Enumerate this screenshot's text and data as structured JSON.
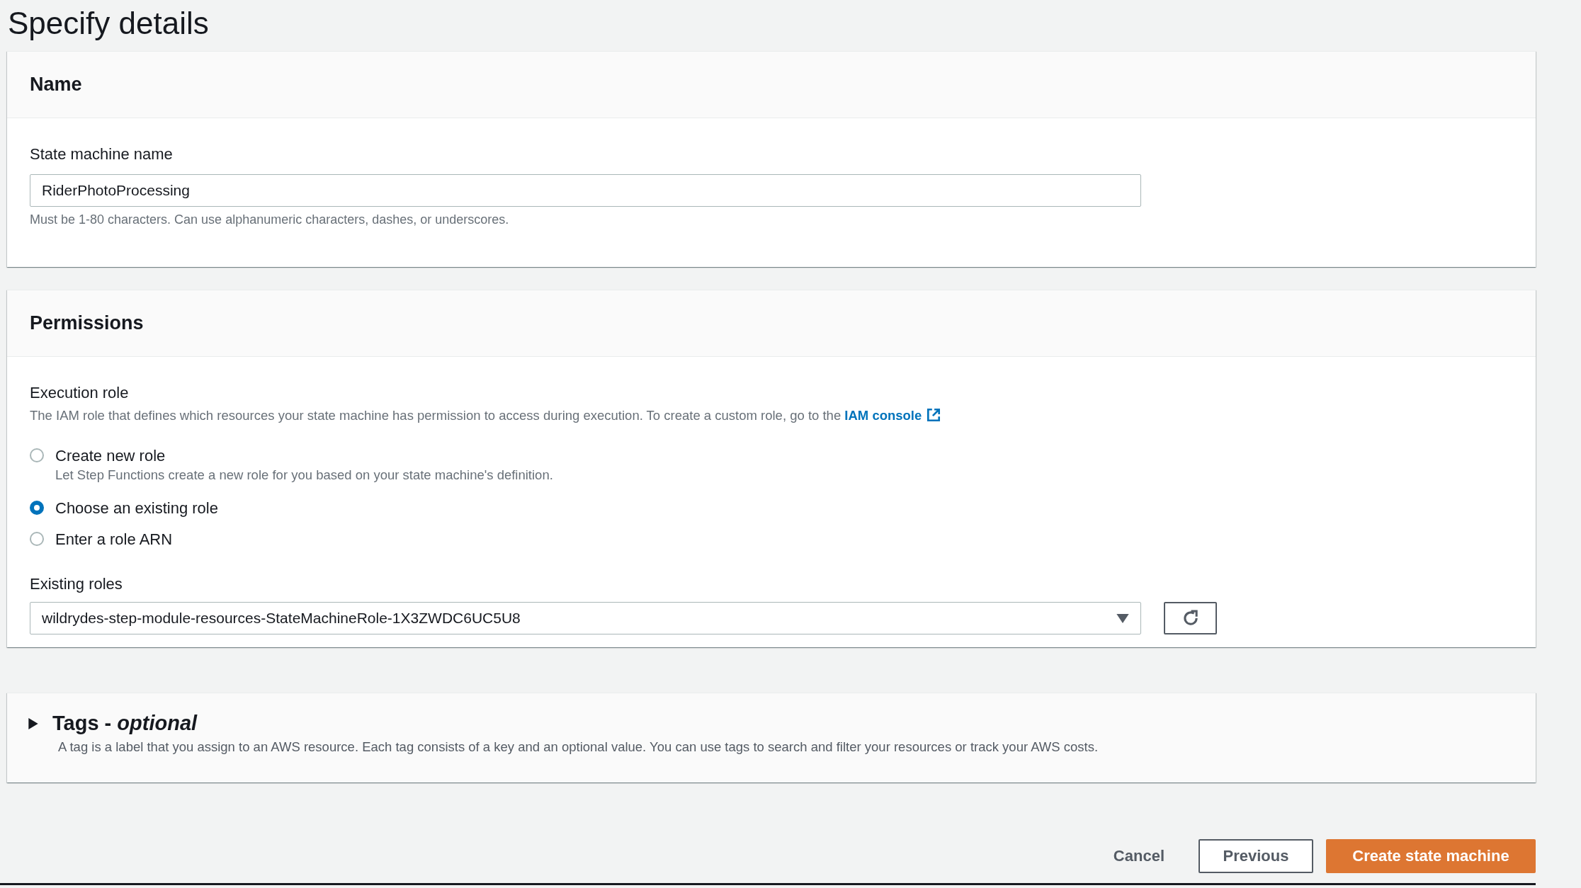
{
  "page_title": "Specify details",
  "name_section": {
    "heading": "Name",
    "field_label": "State machine name",
    "value": "RiderPhotoProcessing",
    "hint": "Must be 1-80 characters. Can use alphanumeric characters, dashes, or underscores."
  },
  "permissions_section": {
    "heading": "Permissions",
    "field_label": "Execution role",
    "description": "The IAM role that defines which resources your state machine has permission to access during execution. To create a custom role, go to the",
    "link": "IAM console",
    "options": [
      {
        "label": "Create new role",
        "description": "Let Step Functions create a new role for you based on your state machine's definition.",
        "selected": false
      },
      {
        "label": "Choose an existing role",
        "selected": true
      },
      {
        "label": "Enter a role ARN",
        "selected": false
      }
    ],
    "select_label": "Existing roles",
    "select_value": "wildrydes-step-module-resources-StateMachineRole-1X3ZWDC6UC5U8"
  },
  "tags_section": {
    "heading": "Tags - *optional*",
    "expanded": false,
    "description": "A tag is a label that you assign to an AWS resource. Each tag consists of a key and an optional value. You can use tags to search and filter your resources or track your AWS costs."
  },
  "buttons": [
    {
      "label": "Cancel",
      "kind": "link"
    },
    {
      "label": "Previous",
      "kind": "secondary"
    },
    {
      "label": "Create state machine",
      "kind": "primary"
    }
  ]
}
